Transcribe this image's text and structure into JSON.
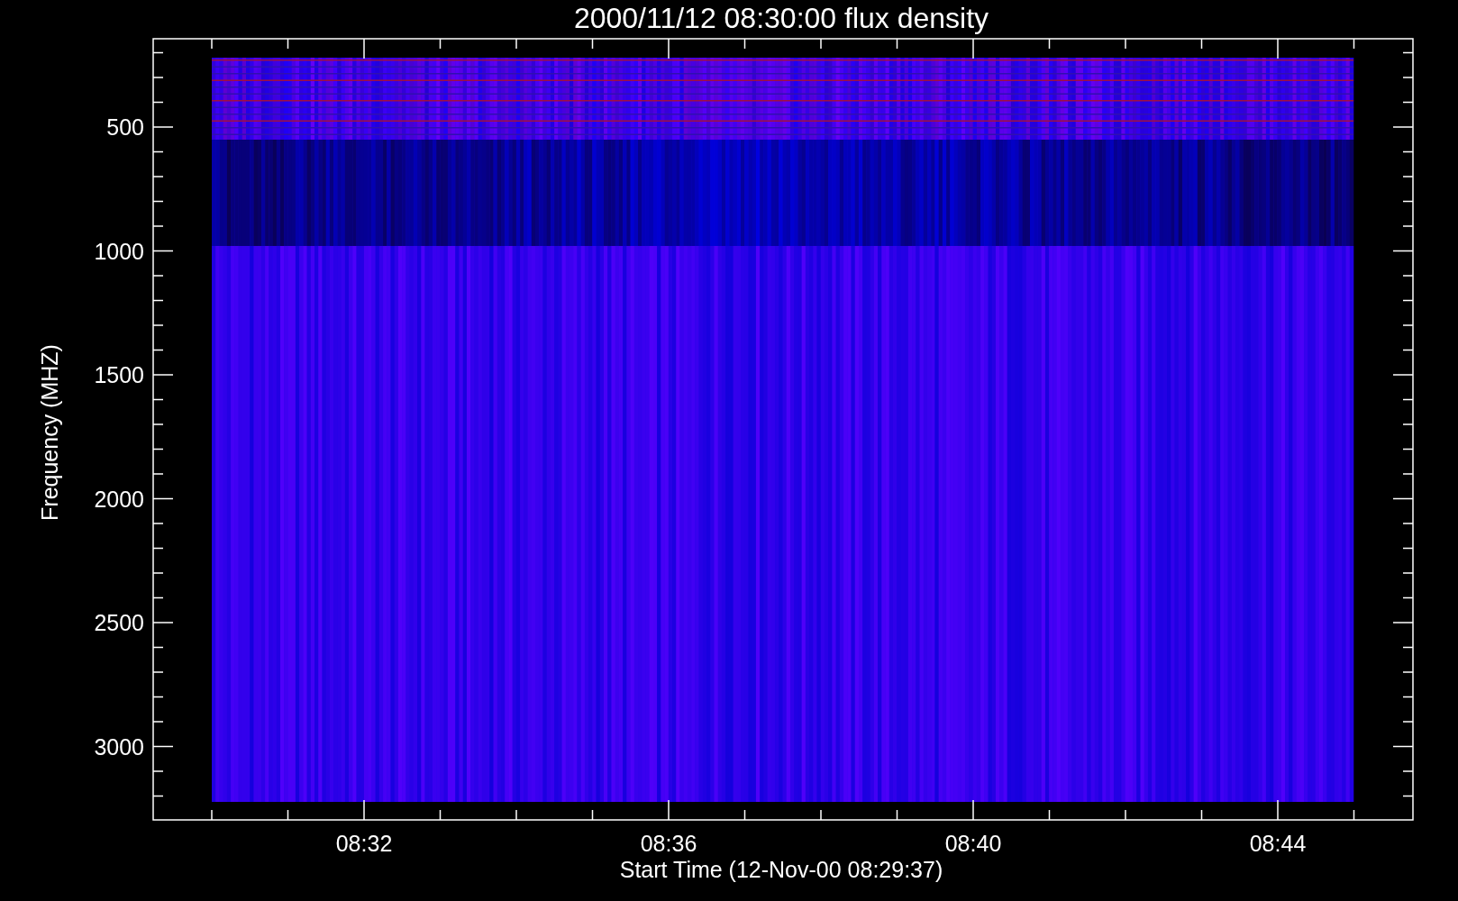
{
  "title": "2000/11/12 08:30:00 flux density",
  "y_axis": {
    "label": "Frequency (MHZ)",
    "ticks": [
      "500",
      "1000",
      "1500",
      "2000",
      "2500",
      "3000"
    ]
  },
  "x_axis": {
    "label": "Start Time (12-Nov-00 08:29:37)",
    "ticks": [
      "08:32",
      "08:36",
      "08:40",
      "08:44"
    ]
  }
}
